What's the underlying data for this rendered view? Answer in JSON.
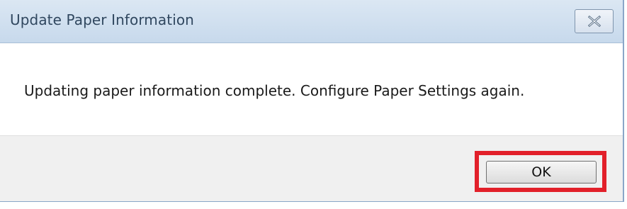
{
  "window": {
    "title": "Update Paper Information",
    "close_icon": "close-icon"
  },
  "message": {
    "text": "Updating paper information complete. Configure Paper Settings again."
  },
  "footer": {
    "ok_label": "OK",
    "highlight_color": "#e2202a"
  }
}
